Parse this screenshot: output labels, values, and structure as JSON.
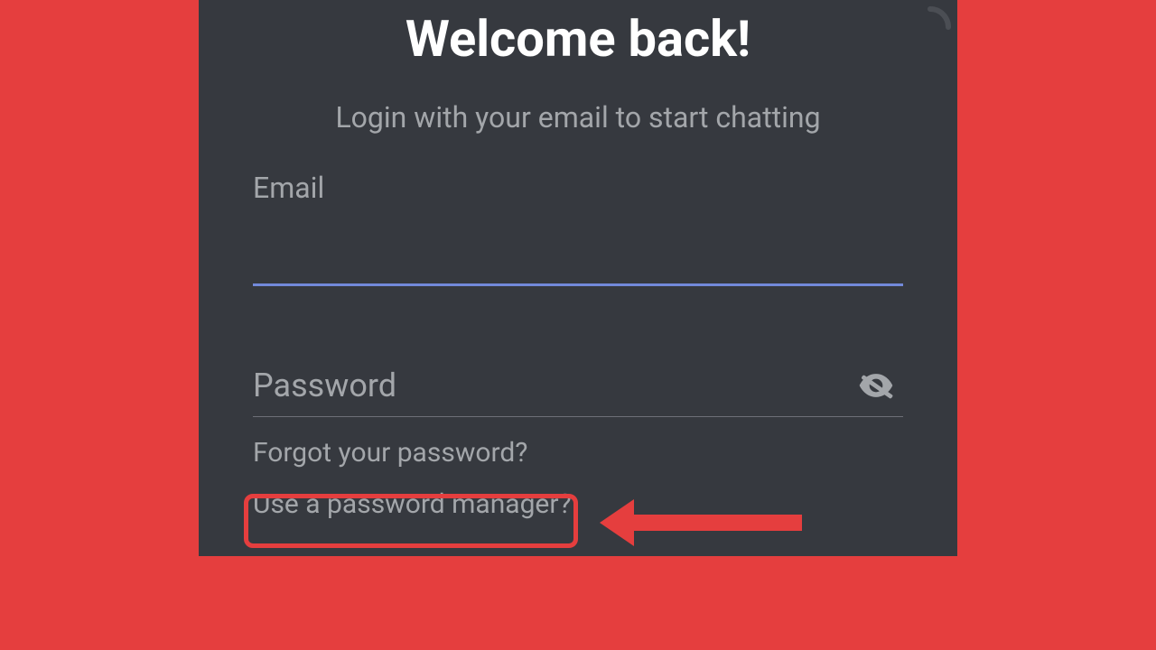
{
  "login": {
    "title": "Welcome back!",
    "subtitle": "Login with your email to start chatting",
    "email_label": "Email",
    "email_value": "",
    "password_placeholder": "Password",
    "password_value": "",
    "forgot_password": "Forgot your password?",
    "password_manager": "Use a password manager?"
  },
  "colors": {
    "background": "#e53e3e",
    "panel": "#36393f",
    "accent": "#7289da",
    "text_muted": "#a3a6aa",
    "text_primary": "#ffffff"
  },
  "annotation": {
    "highlight_target": "forgot-password-link"
  }
}
